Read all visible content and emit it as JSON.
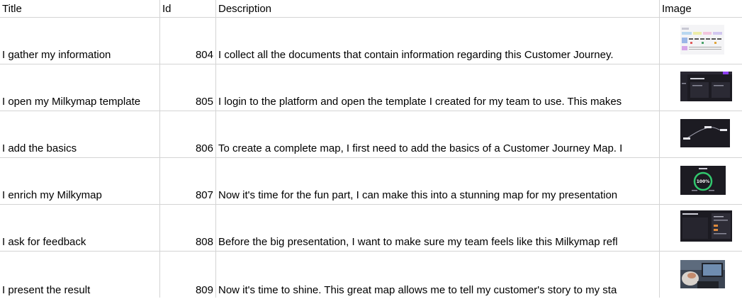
{
  "headers": {
    "title": "Title",
    "id": "Id",
    "description": "Description",
    "image": "Image"
  },
  "rows": [
    {
      "title": "I gather my information",
      "id": "804",
      "description": "I collect all the documents that contain information regarding this Customer Journey.",
      "thumbnail": "document-collage-thumbnail"
    },
    {
      "title": "I open my Milkymap template",
      "id": "805",
      "description": "I login to the platform and open the template I created for my team to use. This makes",
      "thumbnail": "dark-platform-screenshot-thumbnail"
    },
    {
      "title": "I add the basics",
      "id": "806",
      "description": "To create a complete map, I first need to add the basics of a Customer Journey Map. I",
      "thumbnail": "dark-journey-line-thumbnail"
    },
    {
      "title": "I enrich my Milkymap",
      "id": "807",
      "description": "Now it's time for the fun part, I can make this into a stunning map for my presentation",
      "thumbnail": "dark-gauge-thumbnail",
      "gauge_label": "100%"
    },
    {
      "title": "I ask for feedback",
      "id": "808",
      "description": "Before the big presentation, I want to make sure my team feels like this Milkymap refl",
      "thumbnail": "dark-feedback-panel-thumbnail"
    },
    {
      "title": "I present the result",
      "id": "809",
      "description": "Now it's time to shine. This great map allows me to tell my customer's story to my sta",
      "thumbnail": "presentation-photo-thumbnail"
    }
  ],
  "colors": {
    "gridline": "#d4d4d4",
    "thumb_dark": "#1c1b22",
    "accent_purple": "#8b3cf0",
    "gauge_green": "#32c86e"
  }
}
